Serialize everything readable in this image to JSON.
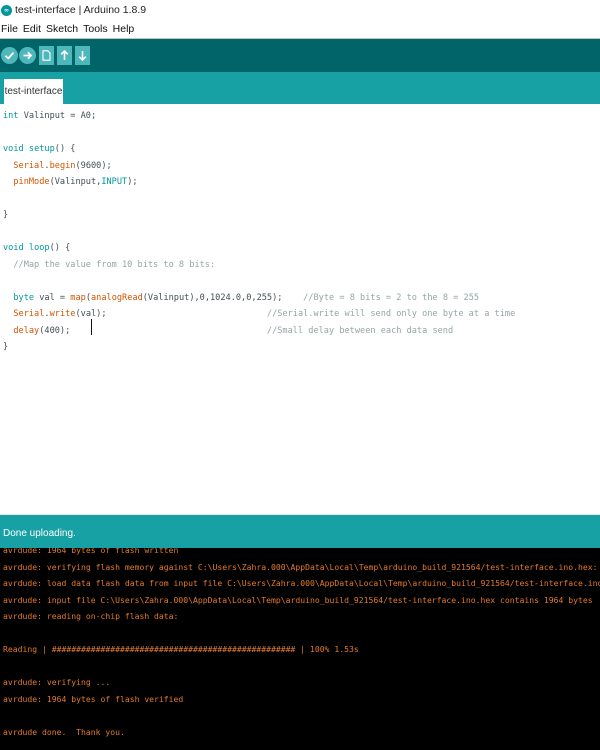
{
  "window": {
    "title": "test-interface | Arduino 1.8.9",
    "app_icon_text": "∞"
  },
  "menu": [
    "File",
    "Edit",
    "Sketch",
    "Tools",
    "Help"
  ],
  "toolbar": {
    "buttons": [
      "verify",
      "upload",
      "new",
      "open",
      "save"
    ],
    "colors": {
      "background": "#006468",
      "button": "#4db7bb"
    }
  },
  "tabs": [
    {
      "label": "test-interface",
      "active": true
    }
  ],
  "editor": {
    "code_lines": [
      [
        [
          "int",
          "ty"
        ],
        [
          " Valinput = A0;",
          ""
        ]
      ],
      [],
      [
        [
          "void",
          "ty"
        ],
        [
          " ",
          ""
        ],
        [
          "setup",
          "kw"
        ],
        [
          "() {",
          ""
        ]
      ],
      [
        [
          "  ",
          ""
        ],
        [
          "Serial",
          "fn"
        ],
        [
          ".",
          ""
        ],
        [
          "begin",
          "fn"
        ],
        [
          "(9600);",
          ""
        ]
      ],
      [
        [
          "  ",
          ""
        ],
        [
          "pinMode",
          "fn"
        ],
        [
          "(Valinput,",
          ""
        ],
        [
          "INPUT",
          "kw"
        ],
        [
          ");",
          ""
        ]
      ],
      [],
      [
        [
          "}",
          ""
        ]
      ],
      [],
      [
        [
          "void",
          "ty"
        ],
        [
          " ",
          ""
        ],
        [
          "loop",
          "kw"
        ],
        [
          "() {",
          ""
        ]
      ],
      [
        [
          "  ",
          ""
        ],
        [
          "//Map the value from 10 bits to 8 bits:",
          "cm"
        ]
      ],
      [],
      [
        [
          "  ",
          ""
        ],
        [
          "byte",
          "ty"
        ],
        [
          " val = ",
          ""
        ],
        [
          "map",
          "fn"
        ],
        [
          "(",
          ""
        ],
        [
          "analogRead",
          "fn"
        ],
        [
          "(Valinput),0,1024.0,0,255);    ",
          ""
        ],
        [
          "//Byte = 8 bits = 2 to the 8 = 255",
          "cm"
        ]
      ],
      [
        [
          "  ",
          ""
        ],
        [
          "Serial",
          "fn"
        ],
        [
          ".",
          ""
        ],
        [
          "write",
          "fn"
        ],
        [
          "(val);                               ",
          ""
        ],
        [
          "//Serial.write will send only one byte at a time",
          "cm"
        ]
      ],
      [
        [
          "  ",
          ""
        ],
        [
          "delay",
          "fn"
        ],
        [
          "(400);                                      ",
          ""
        ],
        [
          "//Small delay between each data send",
          "cm"
        ]
      ],
      [
        [
          "}",
          ""
        ]
      ]
    ]
  },
  "status": {
    "message": "Done uploading."
  },
  "console": {
    "lines": [
      "avrdude: 1964 bytes of flash written",
      "avrdude: verifying flash memory against C:\\Users\\Zahra.000\\AppData\\Local\\Temp\\arduino_build_921564/test-interface.ino.hex:",
      "avrdude: load data flash data from input file C:\\Users\\Zahra.000\\AppData\\Local\\Temp\\arduino_build_921564/test-interface.ino.hex:",
      "avrdude: input file C:\\Users\\Zahra.000\\AppData\\Local\\Temp\\arduino_build_921564/test-interface.ino.hex contains 1964 bytes",
      "avrdude: reading on-chip flash data:",
      "",
      "Reading | ################################################## | 100% 1.53s",
      "",
      "avrdude: verifying ...",
      "avrdude: 1964 bytes of flash verified",
      "",
      "avrdude done.  Thank you."
    ],
    "text_color": "#e37a2d"
  }
}
